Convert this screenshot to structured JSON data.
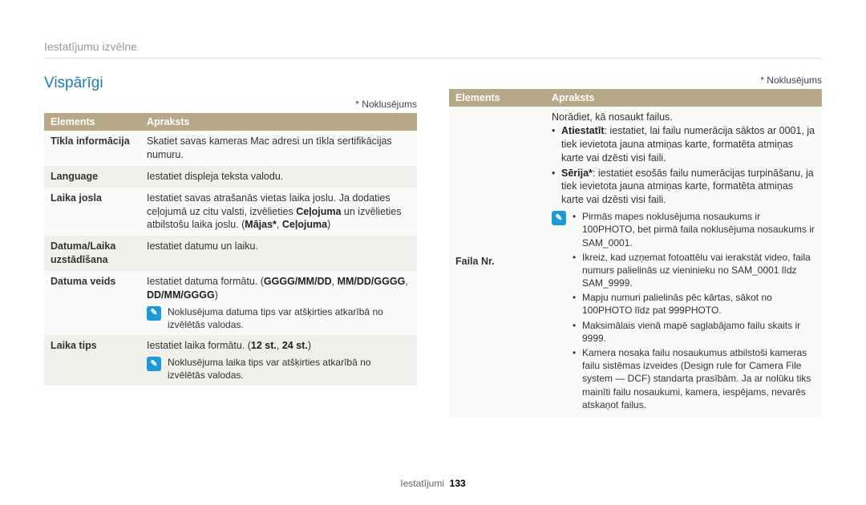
{
  "breadcrumb": "Iestatījumu izvēlne",
  "heading": "Vispārīgi",
  "default_note": "* Noklusējums",
  "table_headers": {
    "col1": "Elements",
    "col2": "Apraksts"
  },
  "left": {
    "rows": [
      {
        "label": "Tīkla informācija",
        "desc": "Skatiet savas kameras Mac adresi un tīkla sertifikācijas numuru."
      },
      {
        "label": "Language",
        "desc": "Iestatiet displeja teksta valodu."
      },
      {
        "label": "Laika josla",
        "desc_pre": "Iestatiet savas atrašanās vietas laika joslu. Ja dodaties ceļojumā uz citu valsti, izvēlieties ",
        "bold1": "Ceļojuma",
        "mid": " un izvēlieties atbilstošu laika joslu. (",
        "bold2": "Mājas*",
        "sep": ", ",
        "bold3": "Ceļojuma",
        "end": ")"
      },
      {
        "label": "Datuma/Laika uzstādīšana",
        "desc": "Iestatiet datumu un laiku."
      },
      {
        "label": "Datuma veids",
        "desc_pre": "Iestatiet datuma formātu. (",
        "bold1": "GGGG/MM/DD",
        "sep1": ", ",
        "bold2": "MM/DD/GGGG",
        "sep2": ", ",
        "bold3": "DD/MM/GGGG",
        "end": ")",
        "note": "Noklusējuma datuma tips var atšķirties atkarībā no izvēlētās valodas."
      },
      {
        "label": "Laika tips",
        "desc_pre": "Iestatiet laika formātu. (",
        "bold1": "12 st.",
        "sep1": ", ",
        "bold2": "24 st.",
        "end": ")",
        "note": "Noklusējuma laika tips var atšķirties atkarībā no izvēlētās valodas."
      }
    ]
  },
  "right": {
    "row": {
      "label": "Faila Nr.",
      "intro": "Norādiet, kā nosaukt failus.",
      "b1_label": "Atiestatīt",
      "b1_rest": ": iestatiet, lai failu numerācija sāktos ar 0001, ja tiek ievietota jauna atmiņas karte, formatēta atmiņas karte vai dzēsti visi faili.",
      "b2_label": "Sērija*",
      "b2_rest": ": iestatiet esošās failu numerācijas turpināšanu, ja tiek ievietota jauna atmiņas karte, formatēta atmiņas karte vai dzēsti visi faili.",
      "notes": [
        "Pirmās mapes noklusējuma nosaukums ir 100PHOTO, bet pirmā faila noklusējuma nosaukums ir SAM_0001.",
        "Ikreiz, kad uzņemat fotoattēlu vai ierakstāt video, faila numurs palielinās uz vieninieku no SAM_0001 līdz SAM_9999.",
        "Mapju numuri palielinās pēc kārtas, sākot no 100PHOTO līdz pat 999PHOTO.",
        "Maksimālais vienā mapē saglabājamo failu skaits ir 9999.",
        "Kamera nosaka failu nosaukumus atbilstoši kameras failu sistēmas izveides (Design rule for Camera File system — DCF) standarta prasībām. Ja ar nolūku tiks mainīti failu nosaukumi, kamera, iespējams, nevarēs atskaņot failus."
      ]
    }
  },
  "footer": {
    "section": "Iestatījumi",
    "page": "133"
  }
}
